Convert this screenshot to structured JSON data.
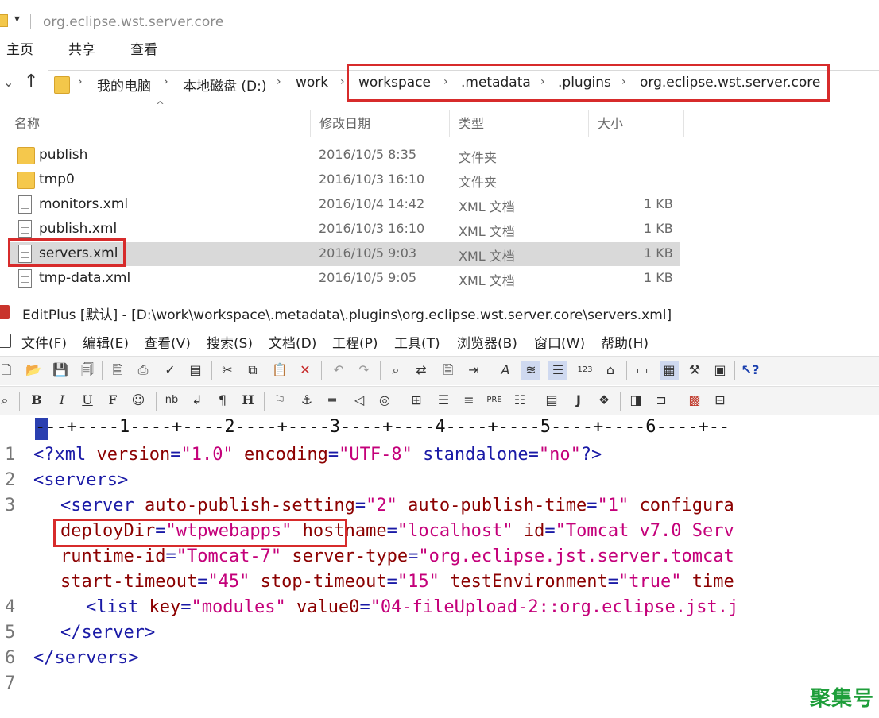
{
  "explorer": {
    "title": "org.eclipse.wst.server.core",
    "ribbon": [
      "主页",
      "共享",
      "查看"
    ],
    "breadcrumb": [
      "我的电脑",
      "本地磁盘 (D:)",
      "work",
      "workspace",
      ".metadata",
      ".plugins",
      "org.eclipse.wst.server.core"
    ],
    "columns": {
      "name": "名称",
      "date": "修改日期",
      "type": "类型",
      "size": "大小"
    },
    "files": [
      {
        "name": "publish",
        "date": "2016/10/5 8:35",
        "type": "文件夹",
        "size": "",
        "icon": "folder-icon"
      },
      {
        "name": "tmp0",
        "date": "2016/10/3 16:10",
        "type": "文件夹",
        "size": "",
        "icon": "folder-icon"
      },
      {
        "name": "monitors.xml",
        "date": "2016/10/4 14:42",
        "type": "XML 文档",
        "size": "1 KB",
        "icon": "xml-file-icon"
      },
      {
        "name": "publish.xml",
        "date": "2016/10/3 16:10",
        "type": "XML 文档",
        "size": "1 KB",
        "icon": "xml-file-icon"
      },
      {
        "name": "servers.xml",
        "date": "2016/10/5 9:03",
        "type": "XML 文档",
        "size": "1 KB",
        "icon": "xml-file-icon",
        "selected": true
      },
      {
        "name": "tmp-data.xml",
        "date": "2016/10/5 9:05",
        "type": "XML 文档",
        "size": "1 KB",
        "icon": "xml-file-icon"
      }
    ]
  },
  "editplus": {
    "title": "EditPlus [默认] - [D:\\work\\workspace\\.metadata\\.plugins\\org.eclipse.wst.server.core\\servers.xml]",
    "menu": [
      "文件(F)",
      "编辑(E)",
      "查看(V)",
      "搜索(S)",
      "文档(D)",
      "工程(P)",
      "工具(T)",
      "浏览器(B)",
      "窗口(W)",
      "帮助(H)"
    ],
    "ruler": "---+----1----+----2----+----3----+----4----+----5----+----6----+--",
    "line_numbers": [
      "1",
      "2",
      "3",
      "",
      "",
      "",
      "4",
      "5",
      "6",
      "7"
    ],
    "code": {
      "l1": {
        "a": "<?xml ",
        "b": "version",
        "c": "=",
        "d": "\"1.0\"",
        "e": " ",
        "f": "encoding",
        "g": "=",
        "h": "\"UTF-8\"",
        "i": " standalone=",
        "j": "\"no\"",
        "k": "?>"
      },
      "l2": "<servers>",
      "l3a": {
        "t": "<server ",
        "a1": "auto-publish-setting",
        "v1": "\"2\"",
        "a2": "auto-publish-time",
        "v2": "\"1\"",
        "a3": "configura"
      },
      "l3b": {
        "a1": "deployDir",
        "v1": "\"wtpwebapps\"",
        "a2": "hostname",
        "v2": "\"localhost\"",
        "a3": "id",
        "v3": "\"Tomcat v7.0 Serv"
      },
      "l3c": {
        "a1": "runtime-id",
        "v1": "\"Tomcat-7\"",
        "a2": "server-type",
        "v2": "\"org.eclipse.jst.server.tomcat"
      },
      "l3d": {
        "a1": "start-timeout",
        "v1": "\"45\"",
        "a2": "stop-timeout",
        "v2": "\"15\"",
        "a3": "testEnvironment",
        "v3": "\"true\"",
        "a4": "time"
      },
      "l4": {
        "t": "<list ",
        "a1": "key",
        "v1": "\"modules\"",
        "a2": "value0",
        "v2": "\"04-fileUpload-2::org.eclipse.jst.j"
      },
      "l5": "</server>",
      "l6": "</servers>"
    }
  },
  "watermark": "聚集号",
  "colors": {
    "highlight_box": "#d72b2b",
    "tag": "#1a1aa6",
    "attribute": "#8b0000",
    "value": "#c4007a",
    "selection": "#d9d9d9"
  }
}
